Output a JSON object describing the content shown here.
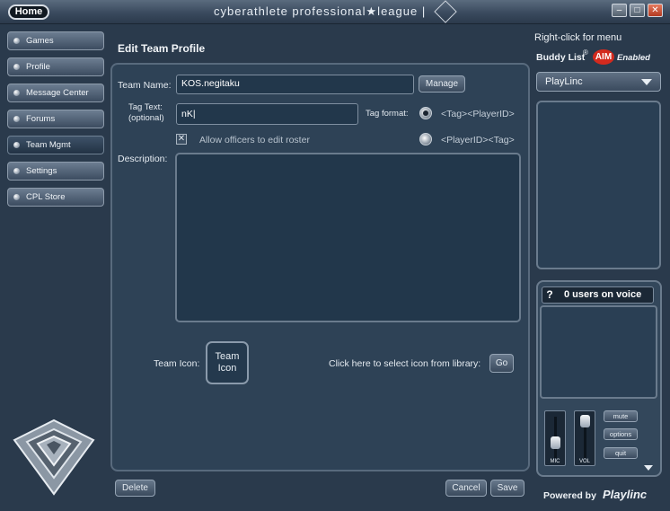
{
  "titlebar": {
    "home_label": "Home",
    "brand": "cyberathlete professional★league |"
  },
  "nav": {
    "items": [
      {
        "label": "Games"
      },
      {
        "label": "Profile"
      },
      {
        "label": "Message Center"
      },
      {
        "label": "Forums"
      },
      {
        "label": "Team Mgmt"
      },
      {
        "label": "Settings"
      },
      {
        "label": "CPL Store"
      }
    ],
    "active": "Team Mgmt"
  },
  "form": {
    "title": "Edit Team Profile",
    "team_name_label": "Team Name:",
    "team_name_value": "KOS.negitaku",
    "manage_label": "Manage",
    "tag_text_label_1": "Tag Text:",
    "tag_text_label_2": "(optional)",
    "tag_text_value": "nK|",
    "tag_format_label": "Tag format:",
    "tag_format_option_1": "<Tag><PlayerID>",
    "tag_format_option_2": "<PlayerID><Tag>",
    "allow_officers_label": "Allow officers to edit roster",
    "description_label": "Description:",
    "team_icon_label": "Team Icon:",
    "team_icon_placeholder_1": "Team",
    "team_icon_placeholder_2": "Icon",
    "library_label": "Click here to select icon from library:",
    "go_label": "Go",
    "delete_label": "Delete",
    "cancel_label": "Cancel",
    "save_label": "Save"
  },
  "right": {
    "right_click_hint": "Right-click for menu",
    "buddy_list_label": "Buddy List",
    "registered_mark": "®",
    "aim_label": "AIM",
    "enabled_label": "Enabled",
    "dropdown_value": "PlayLinc",
    "voice_header": "0 users on voice",
    "help_glyph": "?",
    "mic_label": "MIC",
    "vol_label": "VOL",
    "mute_label": "mute",
    "options_label": "options",
    "quit_label": "quit",
    "powered_by": "Powered by",
    "playlinc": "Playlinc"
  }
}
